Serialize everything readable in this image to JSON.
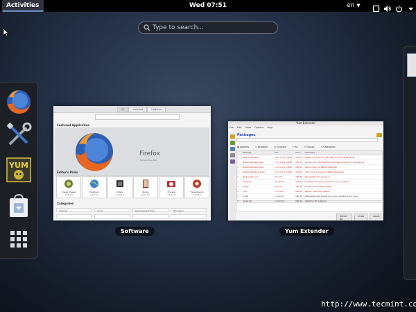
{
  "topbar": {
    "activities": "Activities",
    "clock": "Wed 07:51",
    "language": "en",
    "tray_icons": [
      "screen-icon",
      "volume-icon",
      "power-icon"
    ]
  },
  "search": {
    "placeholder": "Type to search..."
  },
  "dash": {
    "apps": [
      "firefox-icon",
      "tools-icon",
      "yumex-icon",
      "software-bag-icon",
      "app-grid-icon"
    ]
  },
  "windows": {
    "software": {
      "label": "Software",
      "tabs": [
        "All",
        "Installed",
        "Updates"
      ],
      "featured_heading": "Featured Application",
      "featured_title": "Firefox",
      "featured_sub": "Browse the Web",
      "picks_heading": "Editor's Picks",
      "picks": [
        "Image Viewer",
        "Epiphany",
        "Videos",
        "Books",
        "Cheese",
        "Transmission"
      ],
      "categories_heading": "Categories",
      "categories": [
        "Internet",
        "Audio",
        "Development Tools",
        "Education"
      ]
    },
    "yum": {
      "label": "Yum Extender",
      "title": "Yum Extender",
      "menu": [
        "File",
        "Edit",
        "View",
        "Options",
        "Help"
      ],
      "packages_heading": "Packages",
      "filters": [
        "Updates",
        "Available",
        "Installed",
        "All",
        "Groups",
        "Categories"
      ],
      "columns": [
        "Package",
        "Ver.",
        "Arch.",
        "Summary"
      ],
      "rows": [
        {
          "pkg": "NetworkManager",
          "ver": "1:0.9.9.1-13.git20",
          "arch": "x86_64",
          "sum": "Network connection manager and user applications",
          "style": "red"
        },
        {
          "pkg": "NetworkManager-glib",
          "ver": "1:0.9.9.1-13.git20",
          "arch": "x86_64",
          "sum": "Libraries for adding NetworkManager support to applications",
          "style": "red"
        },
        {
          "pkg": "NetworkManager-adsl",
          "ver": "1:0.9.9.1-13.git20",
          "arch": "x86_64",
          "sum": "ADSL plugin for NetworkManager",
          "style": "red"
        },
        {
          "pkg": "NetworkManager-team",
          "ver": "1:0.9.9.1-13.git20",
          "arch": "x86_64",
          "sum": "Team device plugin for NetworkManager",
          "style": "red"
        },
        {
          "pkg": "PackageKit-yum",
          "ver": "0.8.17-1",
          "arch": "x86_64",
          "sum": "PackageKit Yum backend",
          "style": "red"
        },
        {
          "pkg": "fileystem",
          "ver": "3.2-15.el7",
          "arch": "x86_64",
          "sum": "The basic directory layout for a Linux system",
          "style": "red"
        },
        {
          "pkg": "firefox",
          "ver": "24.5.0-1",
          "arch": "x86_64",
          "sum": "Mozilla Firefox Web browser",
          "style": "red"
        },
        {
          "pkg": "grep",
          "ver": "2.20-1.el7",
          "arch": "x86_64",
          "sum": "Pattern matching utilities",
          "style": "red"
        },
        {
          "pkg": "grub2",
          "ver": "1:2.02-0.2",
          "arch": "x86_64",
          "sum": "Bootloader with support for Linux, Multiboot and more",
          "style": "dark"
        },
        {
          "pkg": "grub2-efi",
          "ver": "1:2.02-0.2",
          "arch": "x86_64",
          "sum": "GRUB for EFI systems",
          "style": "dark"
        }
      ],
      "buttons": [
        "Select All",
        "Undo",
        "Apply"
      ]
    }
  },
  "watermark": "http://www.tecmint.com"
}
